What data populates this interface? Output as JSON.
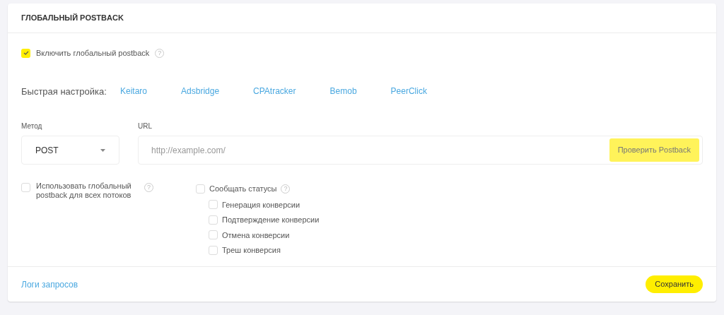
{
  "card": {
    "title": "ГЛОБАЛЬНЫЙ POSTBACK"
  },
  "enable": {
    "label": "Включить глобальный postback",
    "checked": true,
    "help": "?"
  },
  "quick_setup": {
    "label": "Быстрая настройка:",
    "links": [
      "Keitaro",
      "Adsbridge",
      "CPAtracker",
      "Bemob",
      "PeerClick"
    ]
  },
  "method": {
    "label": "Метод",
    "value": "POST"
  },
  "url": {
    "label": "URL",
    "placeholder": "http://example.com/",
    "button": "Проверить Postback"
  },
  "use_global": {
    "label": "Использовать глобальный postback для всех потоков",
    "checked": false,
    "help": "?"
  },
  "report_statuses": {
    "label": "Сообщать статусы",
    "checked": false,
    "help": "?",
    "items": [
      {
        "label": "Генерация конверсии",
        "checked": false
      },
      {
        "label": "Подтверждение конверсии",
        "checked": false
      },
      {
        "label": "Отмена конверсии",
        "checked": false
      },
      {
        "label": "Треш конверсия",
        "checked": false
      }
    ]
  },
  "footer": {
    "link": "Логи запросов",
    "save": "Сохранить"
  }
}
